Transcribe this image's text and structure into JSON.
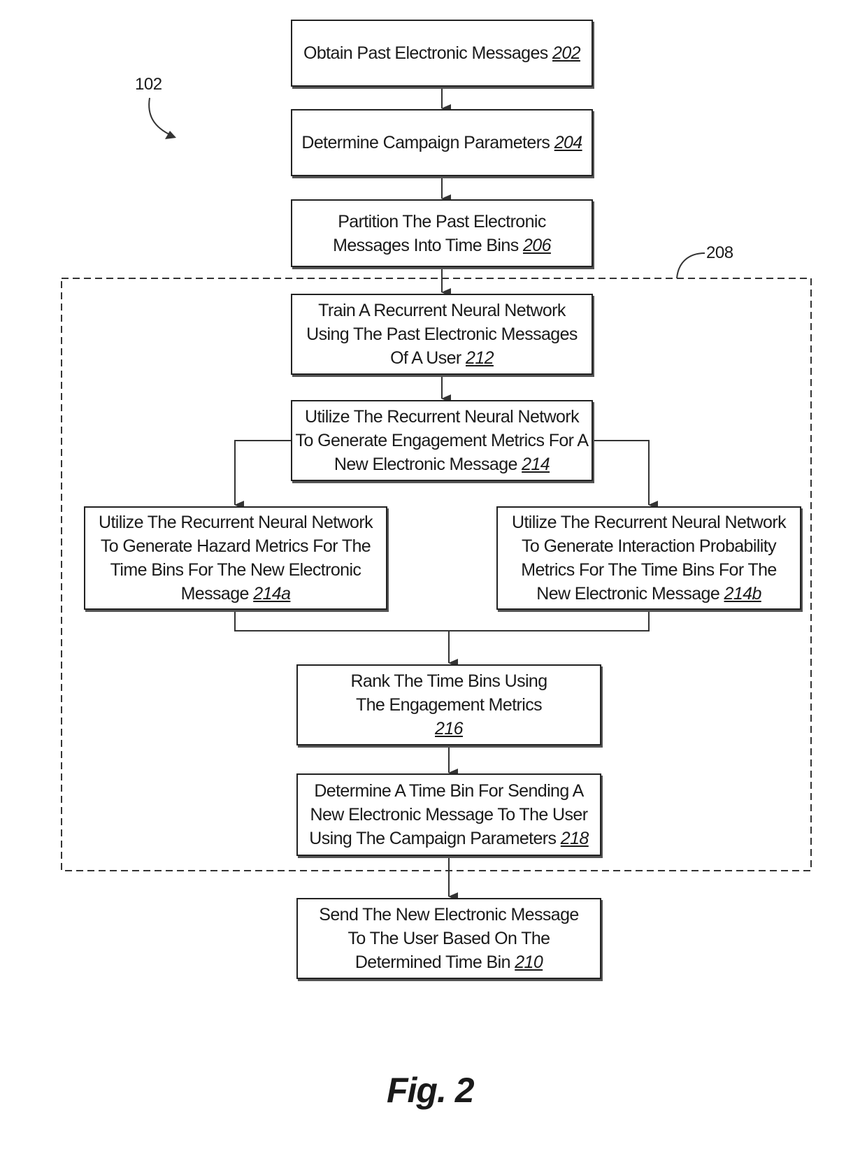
{
  "figure": {
    "title": "Fig. 2",
    "reference_label": "102",
    "group_label": "208"
  },
  "steps": {
    "s202": {
      "text": "Obtain Past Electronic Messages",
      "ref": "202"
    },
    "s204": {
      "text": "Determine Campaign Parameters",
      "ref": "204"
    },
    "s206": {
      "text": "Partition The Past Electronic Messages Into Time Bins",
      "ref": "206"
    },
    "s212": {
      "text": "Train A Recurrent Neural Network Using The Past Electronic Messages Of A User",
      "ref": "212"
    },
    "s214": {
      "text": "Utilize The Recurrent Neural Network To Generate Engagement Metrics For A New Electronic Message",
      "ref": "214"
    },
    "s214a": {
      "text": "Utilize The Recurrent Neural Network To Generate Hazard Metrics For The Time Bins For The New Electronic Message",
      "ref": "214a"
    },
    "s214b": {
      "text": "Utilize The Recurrent Neural Network To Generate Interaction Probability Metrics For The Time Bins For The New Electronic Message",
      "ref": "214b"
    },
    "s216": {
      "text": "Rank The Time Bins Using The Engagement Metrics",
      "ref": "216"
    },
    "s218": {
      "text": "Determine A Time Bin For Sending A New Electronic Message To The User Using The Campaign Parameters",
      "ref": "218"
    },
    "s210": {
      "text": "Send The New Electronic Message To The User Based On The Determined Time Bin",
      "ref": "210"
    }
  }
}
